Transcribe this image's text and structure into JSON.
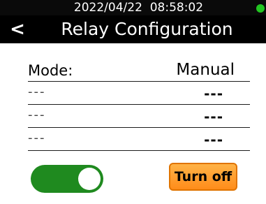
{
  "status_bar": {
    "datetime": "2022/04/22  08:58:02",
    "indicator_color": "#22c521"
  },
  "header": {
    "back_label": "<",
    "title": "Relay Configuration"
  },
  "rows": [
    {
      "label": "Mode:",
      "value": "Manual"
    },
    {
      "label": "---",
      "value": "---"
    },
    {
      "label": "---",
      "value": "---"
    },
    {
      "label": "---",
      "value": "---"
    }
  ],
  "controls": {
    "toggle_state": "on",
    "toggle_color": "#1f8a1f",
    "turn_off_label": "Turn off",
    "turn_off_color": "#ff9a2e"
  }
}
